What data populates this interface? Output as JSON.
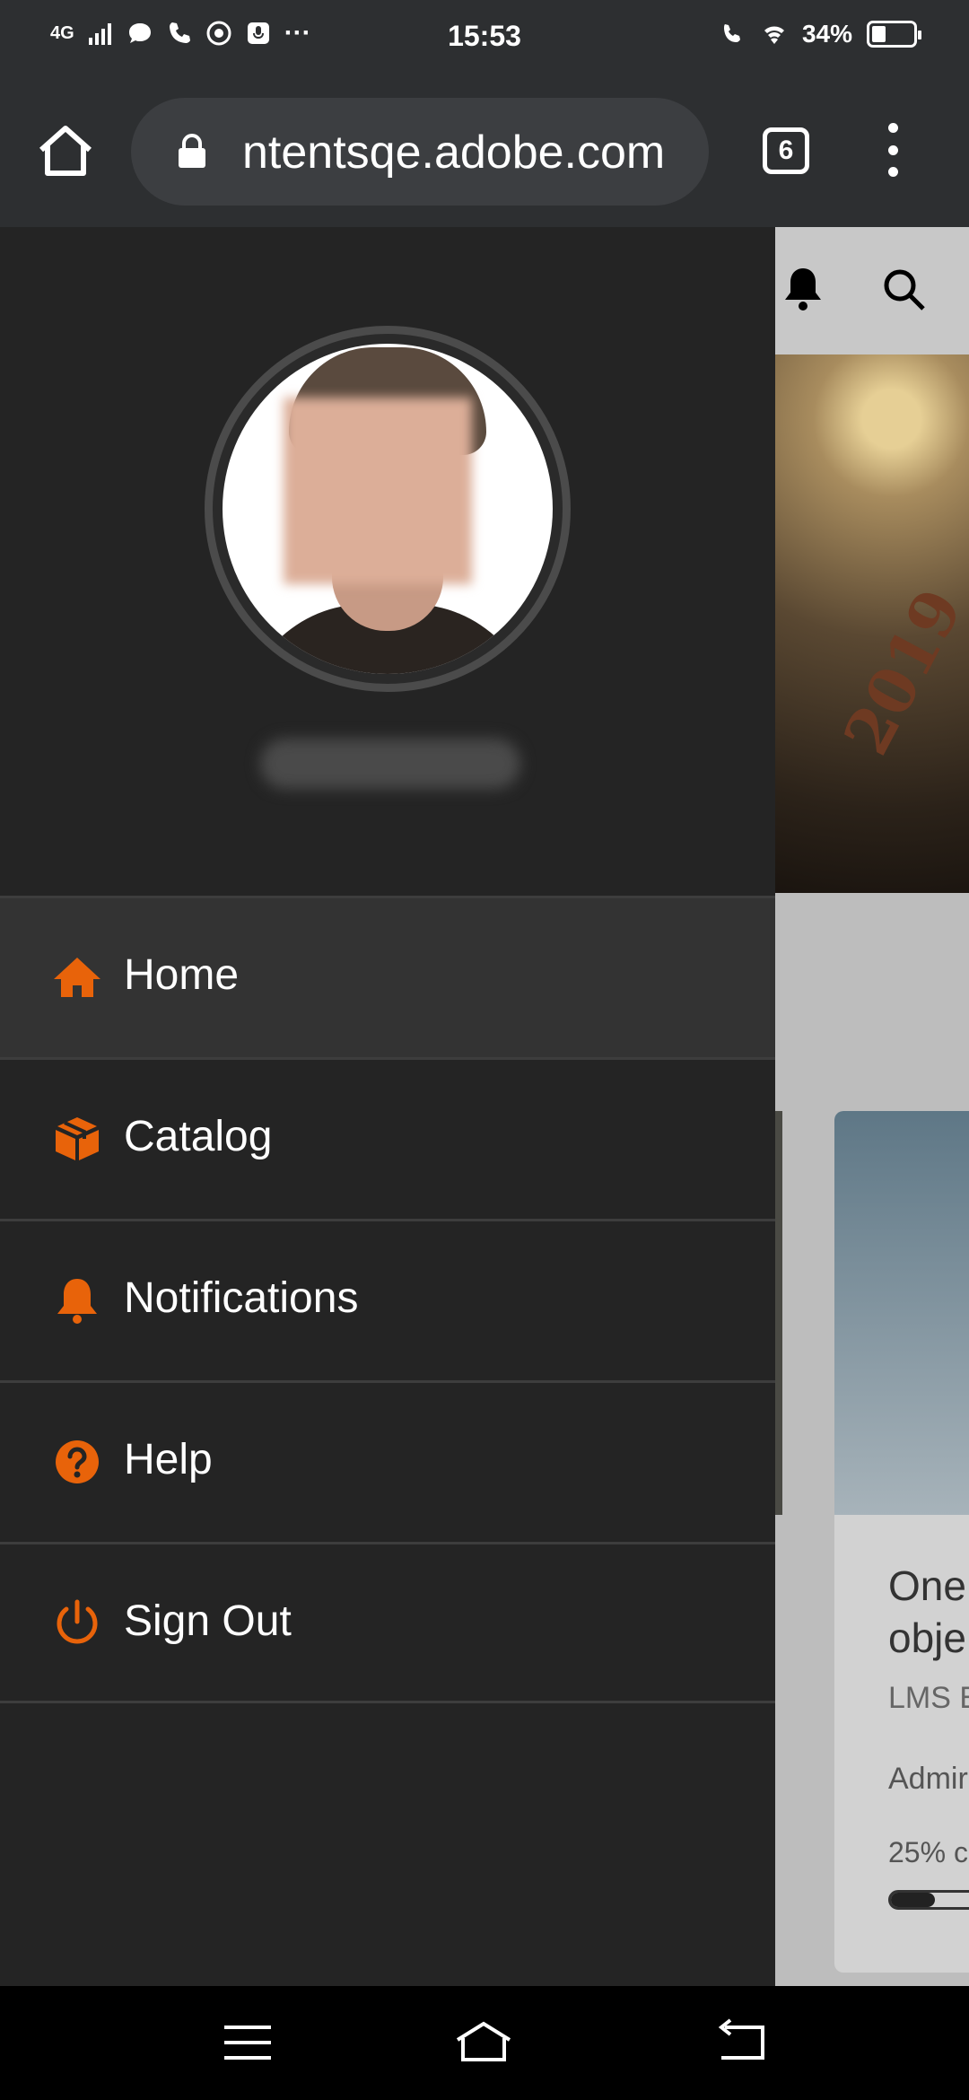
{
  "status_bar": {
    "network": "4G",
    "time": "15:53",
    "battery_percent": "34%",
    "overflow": "···"
  },
  "browser": {
    "url": "ntentsqe.adobe.com",
    "tab_count": "6"
  },
  "drawer": {
    "items": [
      {
        "label": "Home",
        "icon": "home-icon",
        "active": true
      },
      {
        "label": "Catalog",
        "icon": "box-icon",
        "active": false
      },
      {
        "label": "Notifications",
        "icon": "bell-icon",
        "active": false
      },
      {
        "label": "Help",
        "icon": "help-icon",
        "active": false
      },
      {
        "label": "Sign Out",
        "icon": "power-icon",
        "active": false
      }
    ]
  },
  "background_page": {
    "hero_text": "2019",
    "card": {
      "title": "One\nobje",
      "subtitle": "LMS E",
      "author": "Admir",
      "progress_text": "25% c",
      "progress": 0.25
    }
  },
  "colors": {
    "accent": "#e8630a",
    "drawer_bg": "#242424",
    "active_bg": "#333333",
    "toolbar_bg": "#2d2f31"
  }
}
